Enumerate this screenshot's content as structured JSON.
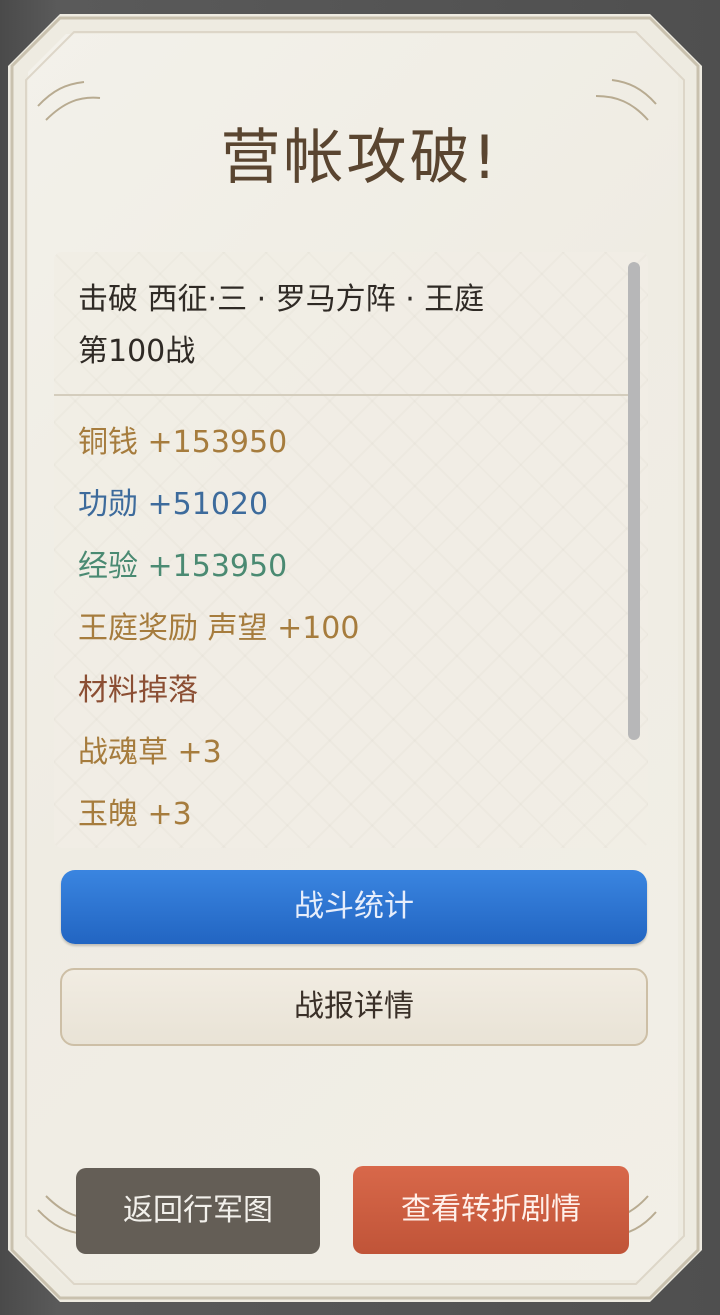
{
  "title": "营帐攻破!",
  "battle": {
    "line1": "击破 西征·三 · 罗马方阵 · 王庭",
    "line2": "第100战"
  },
  "rewards": [
    {
      "text": "铜钱 +153950"
    },
    {
      "text": "功勋 +51020"
    },
    {
      "text": "经验 +153950"
    },
    {
      "text": "王庭奖励 声望 +100"
    },
    {
      "text": "材料掉落"
    },
    {
      "text": "战魂草 +3"
    },
    {
      "text": "玉魄 +3"
    }
  ],
  "buttons": {
    "stats": "战斗统计",
    "report": "战报详情",
    "back": "返回行军图",
    "plot": "查看转折剧情"
  },
  "colors": {
    "gold": "#a67c3d",
    "blue": "#3d6b9c",
    "green": "#4a8a72",
    "brown": "#8b4e33",
    "primary_button": "#2b72d3",
    "secondary_button": "#ede7dc",
    "back_button": "#645e56",
    "plot_button": "#cc5d40"
  }
}
